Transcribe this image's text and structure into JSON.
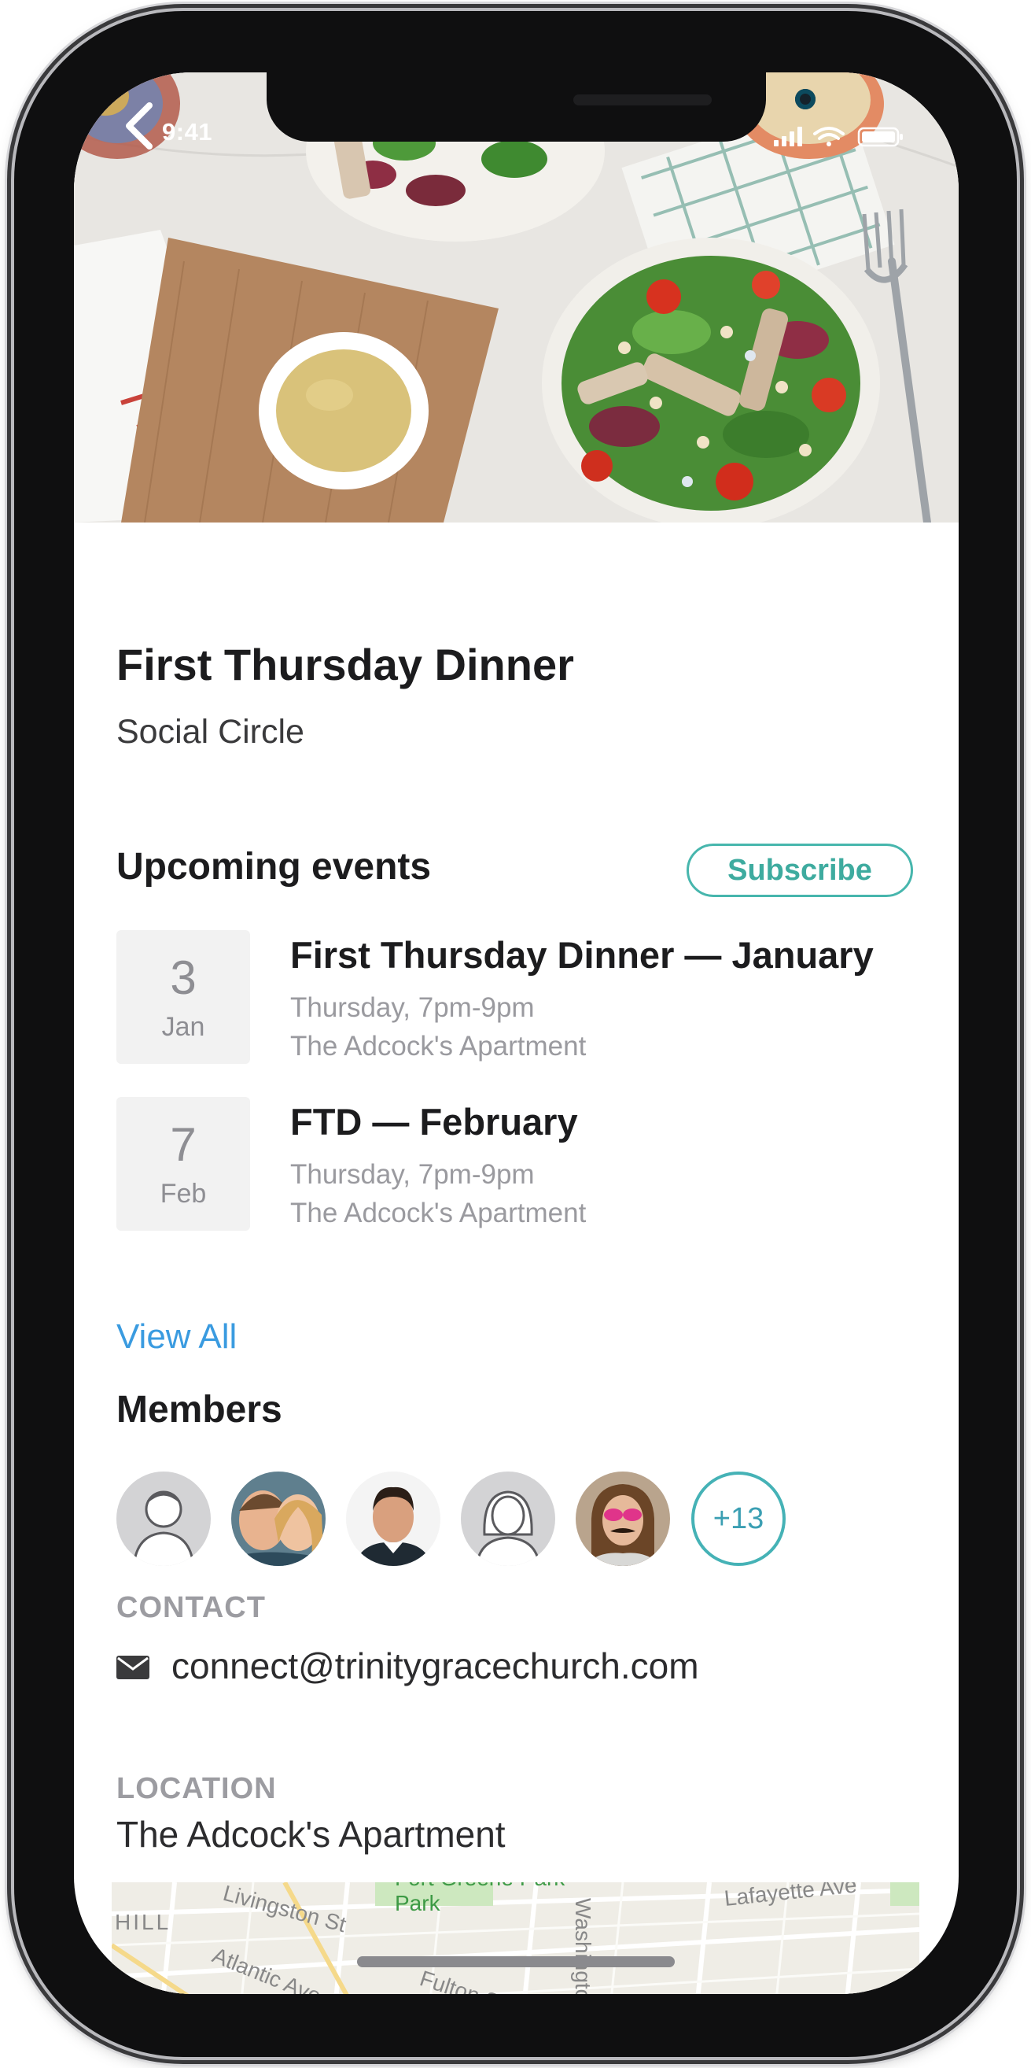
{
  "status_bar": {
    "time": "9:41"
  },
  "group": {
    "title": "First Thursday Dinner",
    "subtitle": "Social Circle"
  },
  "upcoming": {
    "heading": "Upcoming events",
    "subscribe_label": "Subscribe",
    "events": [
      {
        "day": "3",
        "month": "Jan",
        "title": "First Thursday Dinner — January",
        "time": "Thursday, 7pm-9pm",
        "place": "The Adcock's Apartment"
      },
      {
        "day": "7",
        "month": "Feb",
        "title": "FTD — February",
        "time": "Thursday, 7pm-9pm",
        "place": "The Adcock's Apartment"
      }
    ],
    "view_all_label": "View All"
  },
  "members": {
    "heading": "Members",
    "more_count": "+13"
  },
  "contact": {
    "label": "CONTACT",
    "email": "connect@trinitygracechurch.com"
  },
  "location": {
    "label": "LOCATION",
    "name": "The Adcock's Apartment",
    "map_labels": {
      "park": "Fort Greene Park",
      "park_line2": "Park",
      "street1": "Lafayette Ave",
      "street2": "Atlantic Ave",
      "street3": "Fulton St",
      "street4": "Washington Ave",
      "street5": "Livingston St",
      "area": "HILL"
    }
  },
  "colors": {
    "accent_teal": "#47b6ad",
    "link_blue": "#3a9be0",
    "muted_gray": "#9c9ca1"
  },
  "icons": {
    "back": "chevron-left-icon",
    "mail": "envelope-icon",
    "signal": "cellular-signal-icon",
    "wifi": "wifi-icon",
    "battery": "battery-icon"
  }
}
